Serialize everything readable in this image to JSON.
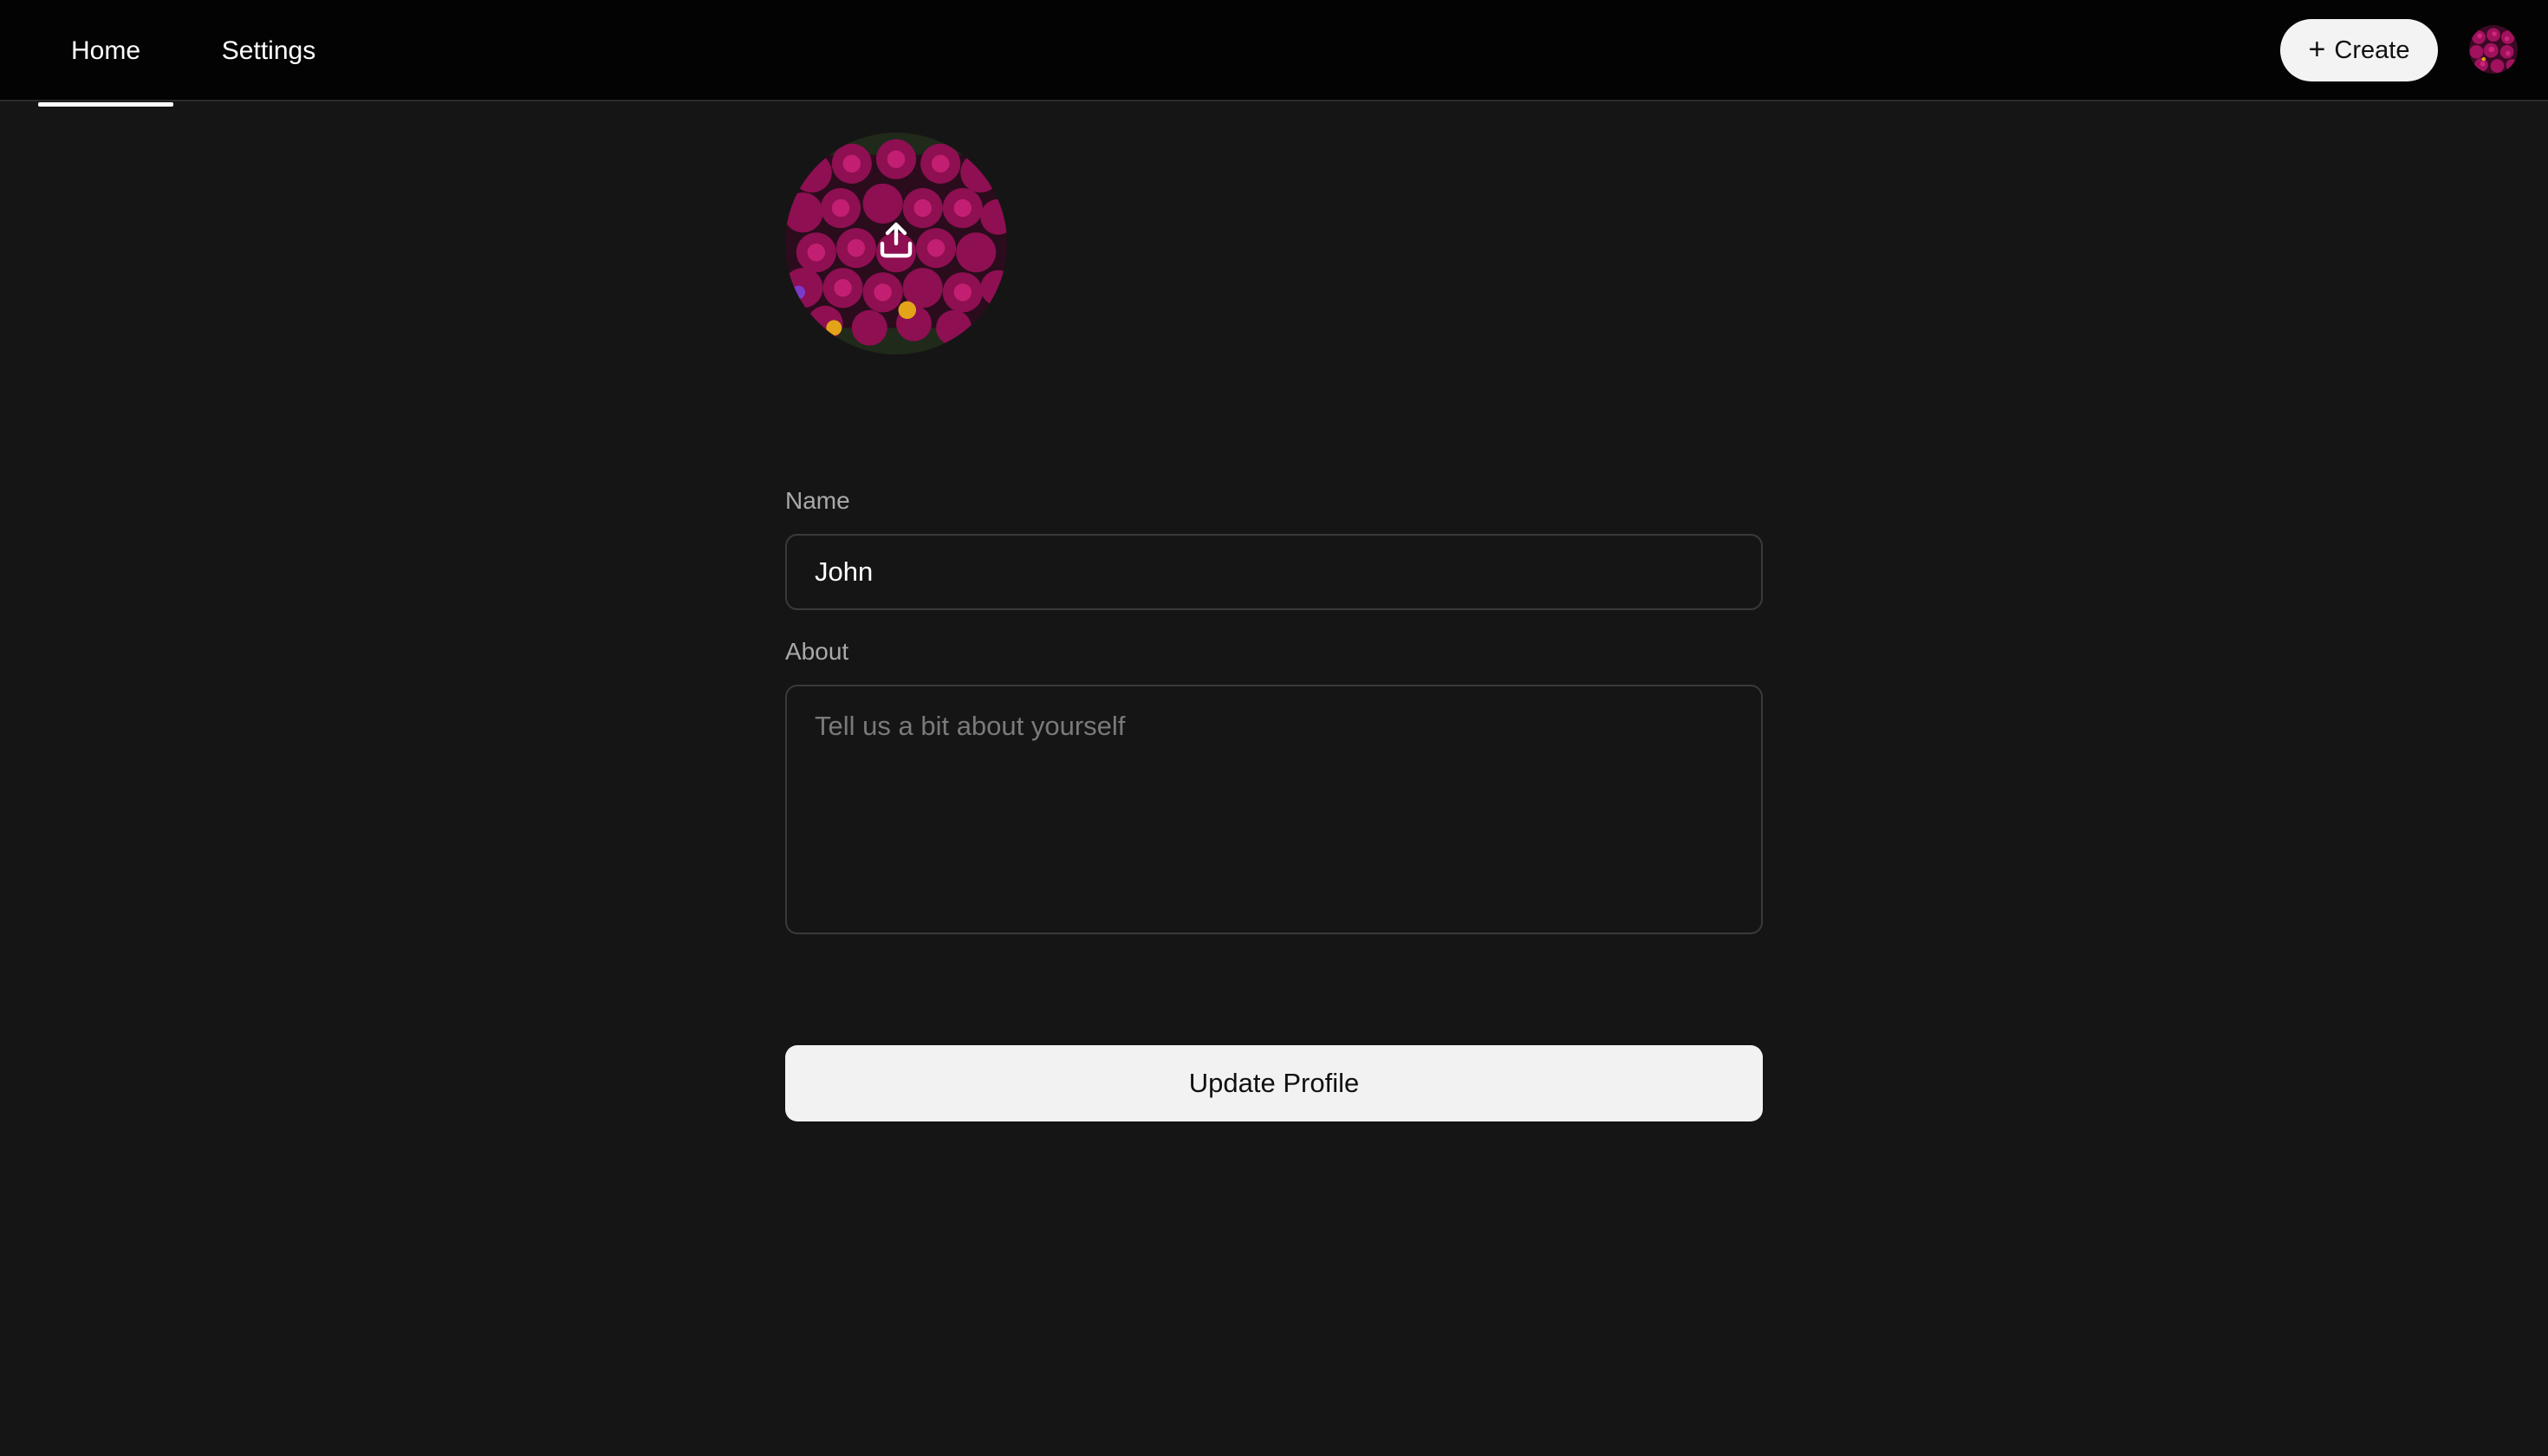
{
  "nav": {
    "tabs": [
      {
        "label": "Home",
        "active": true
      },
      {
        "label": "Settings",
        "active": false
      }
    ],
    "create_label": "Create",
    "create_icon": "plus-icon",
    "avatar_icon": "user-avatar"
  },
  "profile": {
    "avatar_icon": "upload-icon",
    "name_label": "Name",
    "name_value": "John",
    "about_label": "About",
    "about_placeholder": "Tell us a bit about yourself",
    "about_value": "",
    "submit_label": "Update Profile"
  },
  "colors": {
    "background": "#151515",
    "topbar": "#030303",
    "button_bg": "#f3f2f2",
    "flower_magenta": "#a0125e"
  }
}
